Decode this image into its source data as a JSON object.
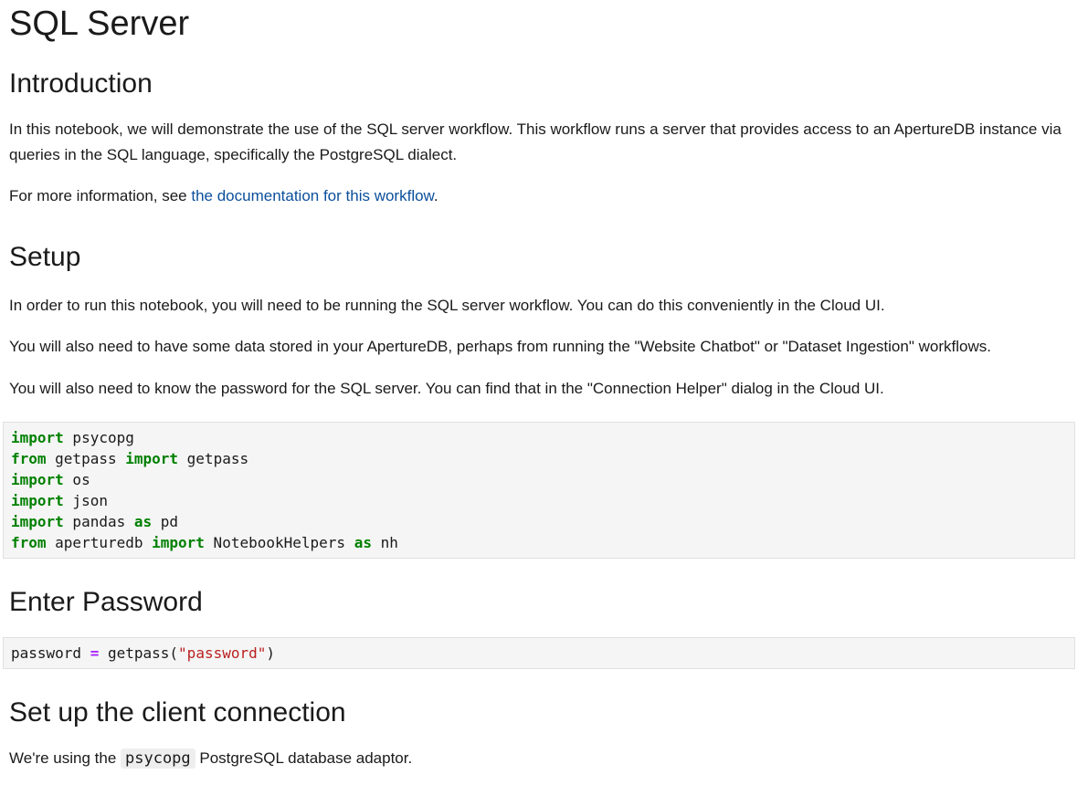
{
  "title": "SQL Server",
  "intro": {
    "heading": "Introduction",
    "p1": "In this notebook, we will demonstrate the use of the SQL server workflow. This workflow runs a server that provides access to an ApertureDB instance via queries in the SQL language, specifically the PostgreSQL dialect.",
    "p2_prefix": "For more information, see ",
    "p2_link": "the documentation for this workflow",
    "p2_suffix": "."
  },
  "setup": {
    "heading": "Setup",
    "p1": "In order to run this notebook, you will need to be running the SQL server workflow. You can do this conveniently in the Cloud UI.",
    "p2": "You will also need to have some data stored in your ApertureDB, perhaps from running the \"Website Chatbot\" or \"Dataset Ingestion\" workflows.",
    "p3": "You will also need to know the password for the SQL server. You can find that in the \"Connection Helper\" dialog in the Cloud UI."
  },
  "code1": {
    "kw_import": "import",
    "kw_from": "from",
    "kw_as": "as",
    "l1_mod": " psycopg",
    "l2_mod": " getpass ",
    "l2_name": " getpass",
    "l3_mod": " os",
    "l4_mod": " json",
    "l5_mod": " pandas ",
    "l5_alias": " pd",
    "l6_mod": " aperturedb ",
    "l6_name": " NotebookHelpers ",
    "l6_alias": " nh"
  },
  "password": {
    "heading": "Enter Password",
    "code_var": "password ",
    "code_op": "=",
    "code_call": " getpass(",
    "code_str": "\"password\"",
    "code_end": ")"
  },
  "connection": {
    "heading": "Set up the client connection",
    "p_prefix": "We're using the ",
    "p_code": "psycopg",
    "p_suffix": " PostgreSQL database adaptor."
  }
}
